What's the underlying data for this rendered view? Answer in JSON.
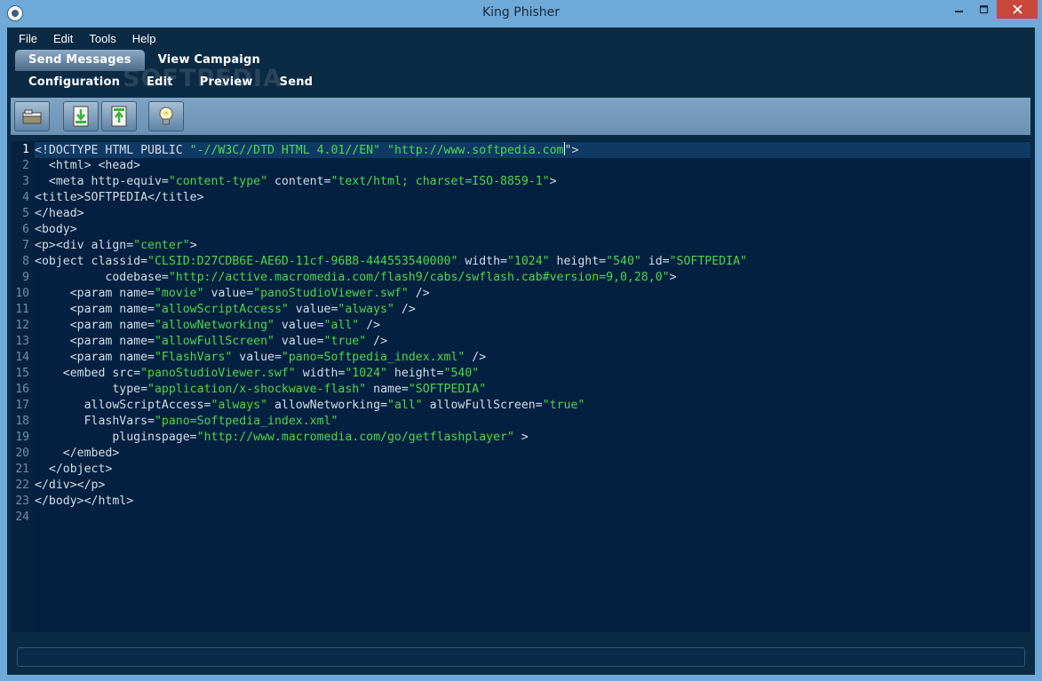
{
  "window": {
    "title": "King Phisher",
    "minimize_icon": "minimize-icon",
    "maximize_icon": "maximize-icon",
    "close_icon": "close-icon"
  },
  "menu": [
    "File",
    "Edit",
    "Tools",
    "Help"
  ],
  "tabs_main": [
    {
      "label": "Send Messages",
      "active": true
    },
    {
      "label": "View Campaign",
      "active": false
    }
  ],
  "tabs_sub": [
    {
      "label": "Configuration",
      "active": true
    },
    {
      "label": "Edit",
      "active": false
    },
    {
      "label": "Preview",
      "active": false
    },
    {
      "label": "Send",
      "active": false
    }
  ],
  "watermark": "SOFTPEDIA",
  "toolbar": {
    "buttons": [
      "open-folder-icon",
      "import-icon",
      "export-icon",
      "lightbulb-icon"
    ]
  },
  "editor": {
    "current_line": 1,
    "colors": {
      "background": "#032040",
      "text": "#d4dde6",
      "string": "#4fd74b",
      "current_line": "#0f3a66"
    },
    "lines": [
      [
        [
          "<!DOCTYPE HTML PUBLIC ",
          "t"
        ],
        [
          "\"-//W3C//DTD HTML 4.01//EN\"",
          "s"
        ],
        [
          " ",
          "t"
        ],
        [
          "\"http://www.softpedia.com",
          "s"
        ],
        [
          "",
          "c"
        ],
        [
          "\">",
          "t"
        ]
      ],
      [
        [
          "  <html> <head>",
          "t"
        ]
      ],
      [
        [
          "  <meta http-equiv=",
          "t"
        ],
        [
          "\"content-type\"",
          "s"
        ],
        [
          " content=",
          "t"
        ],
        [
          "\"text/html; charset=ISO-8859-1\"",
          "s"
        ],
        [
          ">",
          "t"
        ]
      ],
      [
        [
          "<title>SOFTPEDIA</title>",
          "t"
        ]
      ],
      [
        [
          "</head>",
          "t"
        ]
      ],
      [
        [
          "<body>",
          "t"
        ]
      ],
      [
        [
          "<p><div align=",
          "t"
        ],
        [
          "\"center\"",
          "s"
        ],
        [
          ">",
          "t"
        ]
      ],
      [
        [
          "<object classid=",
          "t"
        ],
        [
          "\"CLSID:D27CDB6E-AE6D-11cf-96B8-444553540000\"",
          "s"
        ],
        [
          " width=",
          "t"
        ],
        [
          "\"1024\"",
          "s"
        ],
        [
          " height=",
          "t"
        ],
        [
          "\"540\"",
          "s"
        ],
        [
          " id=",
          "t"
        ],
        [
          "\"SOFTPEDIA\"",
          "s"
        ]
      ],
      [
        [
          "          codebase=",
          "t"
        ],
        [
          "\"http://active.macromedia.com/flash9/cabs/swflash.cab#version=9,0,28,0\"",
          "s"
        ],
        [
          ">",
          "t"
        ]
      ],
      [
        [
          "     <param name=",
          "t"
        ],
        [
          "\"movie\"",
          "s"
        ],
        [
          " value=",
          "t"
        ],
        [
          "\"panoStudioViewer.swf\"",
          "s"
        ],
        [
          " />",
          "t"
        ]
      ],
      [
        [
          "     <param name=",
          "t"
        ],
        [
          "\"allowScriptAccess\"",
          "s"
        ],
        [
          " value=",
          "t"
        ],
        [
          "\"always\"",
          "s"
        ],
        [
          " />",
          "t"
        ]
      ],
      [
        [
          "     <param name=",
          "t"
        ],
        [
          "\"allowNetworking\"",
          "s"
        ],
        [
          " value=",
          "t"
        ],
        [
          "\"all\"",
          "s"
        ],
        [
          " />",
          "t"
        ]
      ],
      [
        [
          "     <param name=",
          "t"
        ],
        [
          "\"allowFullScreen\"",
          "s"
        ],
        [
          " value=",
          "t"
        ],
        [
          "\"true\"",
          "s"
        ],
        [
          " />",
          "t"
        ]
      ],
      [
        [
          "     <param name=",
          "t"
        ],
        [
          "\"FlashVars\"",
          "s"
        ],
        [
          " value=",
          "t"
        ],
        [
          "\"pano=Softpedia_index.xml\"",
          "s"
        ],
        [
          " />",
          "t"
        ]
      ],
      [
        [
          "    <embed src=",
          "t"
        ],
        [
          "\"panoStudioViewer.swf\"",
          "s"
        ],
        [
          " width=",
          "t"
        ],
        [
          "\"1024\"",
          "s"
        ],
        [
          " height=",
          "t"
        ],
        [
          "\"540\"",
          "s"
        ]
      ],
      [
        [
          "           type=",
          "t"
        ],
        [
          "\"application/x-shockwave-flash\"",
          "s"
        ],
        [
          " name=",
          "t"
        ],
        [
          "\"SOFTPEDIA\"",
          "s"
        ]
      ],
      [
        [
          "       allowScriptAccess=",
          "t"
        ],
        [
          "\"always\"",
          "s"
        ],
        [
          " allowNetworking=",
          "t"
        ],
        [
          "\"all\"",
          "s"
        ],
        [
          " allowFullScreen=",
          "t"
        ],
        [
          "\"true\"",
          "s"
        ]
      ],
      [
        [
          "       FlashVars=",
          "t"
        ],
        [
          "\"pano=Softpedia_index.xml\"",
          "s"
        ]
      ],
      [
        [
          "           pluginspage=",
          "t"
        ],
        [
          "\"http://www.macromedia.com/go/getflashplayer\"",
          "s"
        ],
        [
          " >",
          "t"
        ]
      ],
      [
        [
          "    </embed>",
          "t"
        ]
      ],
      [
        [
          "  </object>",
          "t"
        ]
      ],
      [
        [
          "</div></p>",
          "t"
        ]
      ],
      [
        [
          "</body></html>",
          "t"
        ]
      ],
      [
        [
          "",
          "t"
        ]
      ]
    ]
  }
}
